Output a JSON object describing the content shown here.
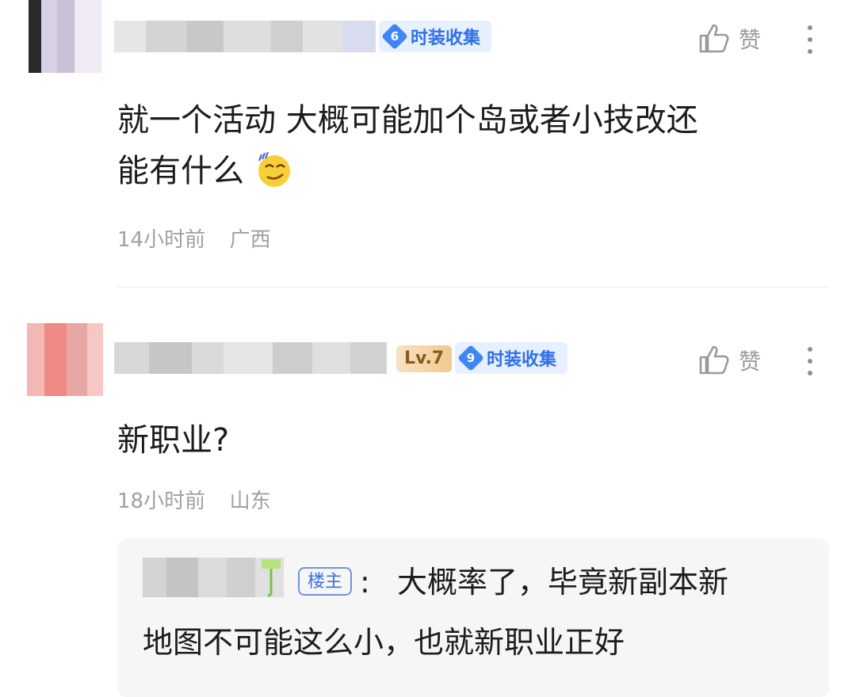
{
  "comments": [
    {
      "badge_fashion_label": "时装收集",
      "badge_fashion_level": "6",
      "like_label": "赞",
      "content_line1": "就一个活动 大概可能加个岛或者小技改还",
      "content_line2": "能有什么",
      "emoji": "smirk-emoji",
      "time": "14小时前",
      "location": "广西"
    },
    {
      "badge_lv_label": "Lv.7",
      "badge_fashion_label": "时装收集",
      "badge_fashion_level": "9",
      "like_label": "赞",
      "content": "新职业?",
      "time": "18小时前",
      "location": "山东",
      "reply": {
        "host_tag": "楼主",
        "colon": ":",
        "text_line1": "大概率了，毕竟新副本新",
        "text_line2": "地图不可能这么小，也就新职业正好"
      }
    }
  ],
  "icons": {
    "like": "thumbs-up-icon",
    "more": "more-vertical-icon"
  },
  "colors": {
    "accent_blue": "#2f6fe8",
    "meta_gray": "#a0a0a0",
    "lv_gold": "#f3c98f"
  }
}
